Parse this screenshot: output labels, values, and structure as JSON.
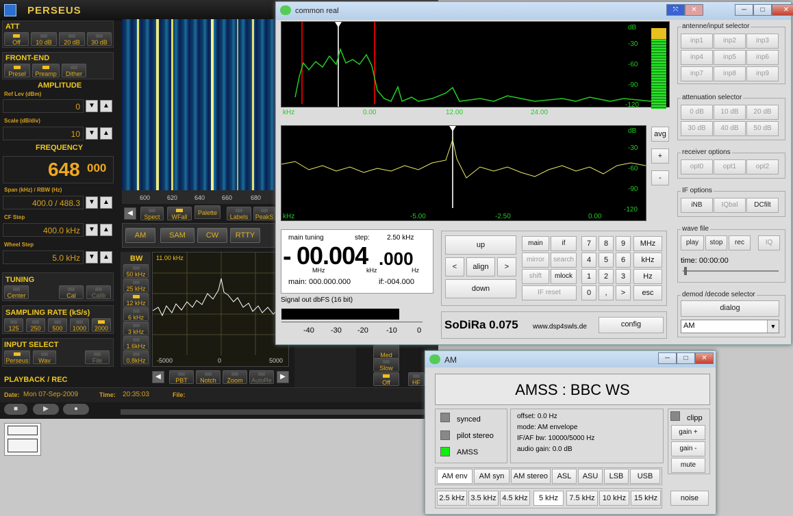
{
  "perseus": {
    "title": "PERSEUS",
    "att": {
      "label": "ATT",
      "buttons": [
        "Off",
        "10 dB",
        "20 dB",
        "30 dB"
      ]
    },
    "frontend": {
      "label": "FRONT-END",
      "buttons": [
        "Presel",
        "Preamp",
        "Dither"
      ]
    },
    "amplitude": {
      "label": "AMPLITUDE",
      "ref_label": "Ref Lev (dBm)",
      "ref_value": "0",
      "scale_label": "Scale (dB/div)",
      "scale_value": "10"
    },
    "frequency": {
      "label": "FREQUENCY",
      "main": "648",
      "frac": "000",
      "span_label": "Span (kHz) / RBW (Hz)",
      "span_value": "400.0 / 488.3",
      "cf_label": "CF Step",
      "cf_value": "400.0 kHz",
      "wheel_label": "Wheel Step",
      "wheel_value": "5.0 kHz"
    },
    "tuning": {
      "label": "TUNING",
      "buttons": [
        "Center",
        "Cal",
        "Calib"
      ]
    },
    "sampling": {
      "label": "SAMPLING RATE (kS/s)",
      "buttons": [
        "125",
        "250",
        "500",
        "1000",
        "2000"
      ]
    },
    "input": {
      "label": "INPUT SELECT",
      "buttons": [
        "Perseus",
        "Wav",
        "File"
      ]
    },
    "playback": {
      "label": "PLAYBACK / REC",
      "date_label": "Date:",
      "date": "Mon 07-Sep-2009",
      "time_label": "Time:",
      "time": "20:35:03",
      "file_label": "File:"
    },
    "wf_ticks": [
      "600",
      "620",
      "640",
      "660",
      "680"
    ],
    "view_buttons": [
      "Spect",
      "WFall",
      "Palette",
      "Labels",
      "PeakS"
    ],
    "modes": [
      "AM",
      "SAM",
      "CW",
      "RTTY"
    ],
    "bw": {
      "label": "BW",
      "value": "11.00 kHz",
      "buttons": [
        "50 kHz",
        "25 kHz",
        "12 kHz",
        "6 kHz",
        "3 kHz",
        "1.6kHz",
        "0.8kHz"
      ]
    },
    "audio_ticks": [
      "-5000",
      "0",
      "5000"
    ],
    "dsp_buttons": [
      "PBT",
      "Notch",
      "Zoom",
      "AutoRe"
    ],
    "agc_buttons": [
      "Med",
      "Slow",
      "Off",
      "HF"
    ]
  },
  "cr": {
    "title": "common real",
    "top_scope": {
      "db": [
        "dB",
        "-30",
        "-60",
        "-90",
        "-120"
      ],
      "x": [
        "kHz",
        "0.00",
        "12.00",
        "24.00"
      ]
    },
    "mid_scope": {
      "db": [
        "dB",
        "-30",
        "-60",
        "-90",
        "-120"
      ],
      "x": [
        "kHz",
        "-5.00",
        "-2.50",
        "0.00"
      ]
    },
    "avg": "avg",
    "plus": "+",
    "minus": "-",
    "antenna": {
      "title": "antenne/input selector",
      "buttons": [
        "inp1",
        "inp2",
        "inp3",
        "inp4",
        "inp5",
        "inp6",
        "inp7",
        "inp8",
        "inp9"
      ]
    },
    "atten": {
      "title": "attenuation selector",
      "buttons": [
        "0 dB",
        "10 dB",
        "20 dB",
        "30 dB",
        "40 dB",
        "50 dB"
      ]
    },
    "recv": {
      "title": "receiver options",
      "buttons": [
        "opt0",
        "opt1",
        "opt2"
      ]
    },
    "ifopt": {
      "title": "IF options",
      "buttons": [
        "iNB",
        "IQbal",
        "DCfilt"
      ]
    },
    "wave": {
      "title": "wave file",
      "buttons": [
        "play",
        "stop",
        "rec",
        "IQ"
      ],
      "time": "time: 00:00:00"
    },
    "demod": {
      "title": "demod /decode selector",
      "dialog": "dialog",
      "selected": "AM"
    },
    "tuning": {
      "main_label": "main tuning",
      "step_label": "step:",
      "step": "2.50  kHz",
      "sign": "-",
      "big": "00.004",
      "small": ".000",
      "mhz": "MHz",
      "khz": "kHz",
      "hz": "Hz",
      "main": "main: 000.000.000",
      "if": "if:-004.000"
    },
    "signal": {
      "label": "Signal out dbFS (16 bit)",
      "ticks": [
        "-40",
        "-30",
        "-20",
        "-10",
        "0"
      ]
    },
    "nav": {
      "up": "up",
      "left": "<",
      "align": "align",
      "right": ">",
      "down": "down"
    },
    "modebtns": [
      "main",
      "if",
      "mirror",
      "search",
      "shift",
      "mlock",
      "IF reset"
    ],
    "keypad": [
      "7",
      "8",
      "9",
      "MHz",
      "4",
      "5",
      "6",
      "kHz",
      "1",
      "2",
      "3",
      "Hz",
      "0",
      ",",
      ">",
      "esc"
    ],
    "brand": "SoDiRa 0.075",
    "url": "www.dsp4swls.de",
    "config": "config"
  },
  "am": {
    "title": "AM",
    "display": "AMSS : BBC WS",
    "status": [
      "synced",
      "pilot stereo",
      "AMSS"
    ],
    "info": [
      "offset: 0.0 Hz",
      "mode: AM envelope",
      "IF/AF bw: 10000/5000 Hz",
      "audio gain: 0.0 dB"
    ],
    "right": {
      "clip": "clipp",
      "gainp": "gain +",
      "gainm": "gain -",
      "mute": "mute"
    },
    "modes": [
      "AM env",
      "AM syn",
      "AM stereo",
      "ASL",
      "ASU",
      "LSB",
      "USB"
    ],
    "bws": [
      "2.5 kHz",
      "3.5 kHz",
      "4.5 kHz",
      "5 kHz",
      "7.5 kHz",
      "10 kHz",
      "15 kHz"
    ],
    "noise": "noise"
  }
}
